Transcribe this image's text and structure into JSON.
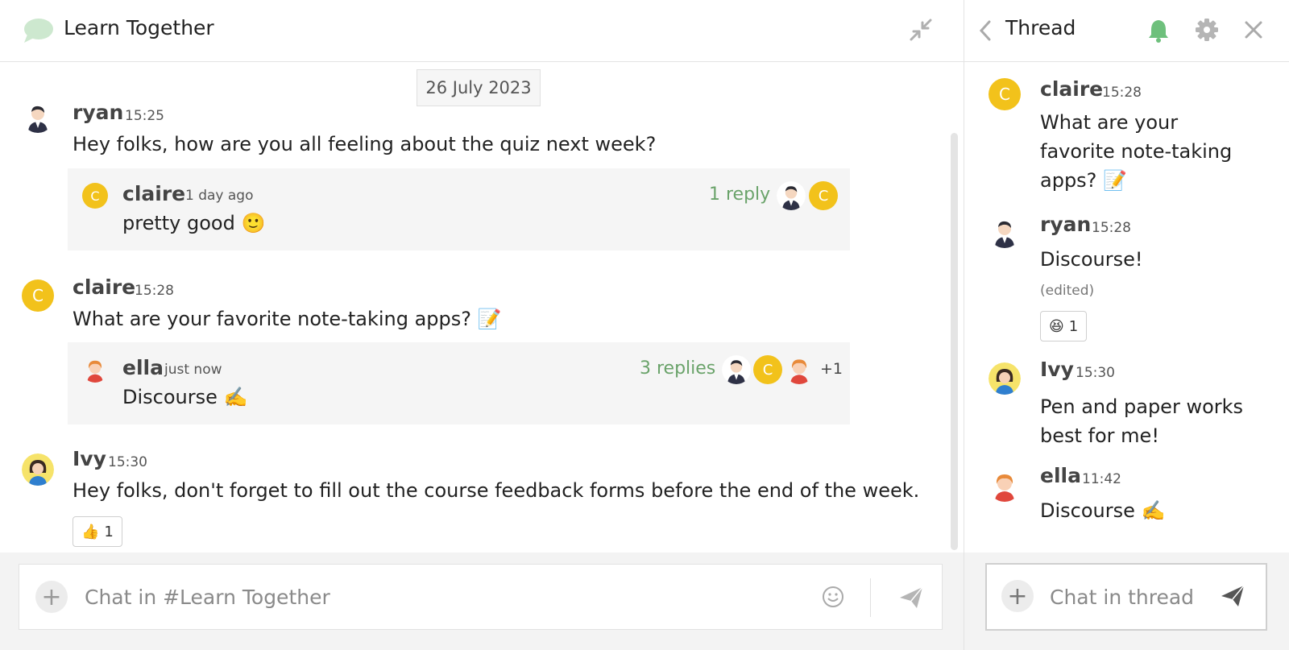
{
  "channel": {
    "title": "Learn Together",
    "date_separator": "26 July 2023"
  },
  "messages": [
    {
      "user": "ryan",
      "time": "15:25",
      "text": "Hey folks, how are you all feeling about the quiz next week?",
      "thread": {
        "user": "claire",
        "time": "1 day ago",
        "text": "pretty good 🙂",
        "replies": "1 reply",
        "avatar_letter": "C"
      }
    },
    {
      "user": "claire",
      "time": "15:28",
      "avatar_letter": "C",
      "text": "What are your favorite note-taking apps? 📝",
      "thread": {
        "user": "ella",
        "time": "just now",
        "text": "Discourse ✍️",
        "replies": "3 replies",
        "avatar_letter": "C",
        "more": "+1"
      }
    },
    {
      "user": "Ivy",
      "time": "15:30",
      "text": "Hey folks, don't forget to fill out the course feedback forms before the end of the week.",
      "reaction": {
        "emoji": "👍",
        "count": "1"
      }
    }
  ],
  "composer": {
    "placeholder": "Chat in #Learn Together"
  },
  "thread_panel": {
    "title": "Thread",
    "messages": [
      {
        "user": "claire",
        "time": "15:28",
        "avatar_letter": "C",
        "text": "What are your favorite note-taking apps? 📝"
      },
      {
        "user": "ryan",
        "time": "15:28",
        "text": "Discourse!",
        "edited": "(edited)",
        "reaction": {
          "emoji": "😆",
          "count": "1"
        }
      },
      {
        "user": "Ivy",
        "time": "15:30",
        "text": "Pen and paper works best for me!"
      },
      {
        "user": "ella",
        "time": "11:42",
        "text": "Discourse ✍️"
      }
    ],
    "composer_placeholder": "Chat in thread"
  },
  "colors": {
    "accent_green": "#6aa36a",
    "avatar_yellow": "#f2c21b",
    "bell_green": "#6ec07c"
  },
  "icons": [
    "speech-bubble-icon",
    "collapse-icon",
    "chevron-left-icon",
    "bell-icon",
    "gear-icon",
    "close-icon",
    "plus-icon",
    "smiley-icon",
    "send-icon"
  ]
}
